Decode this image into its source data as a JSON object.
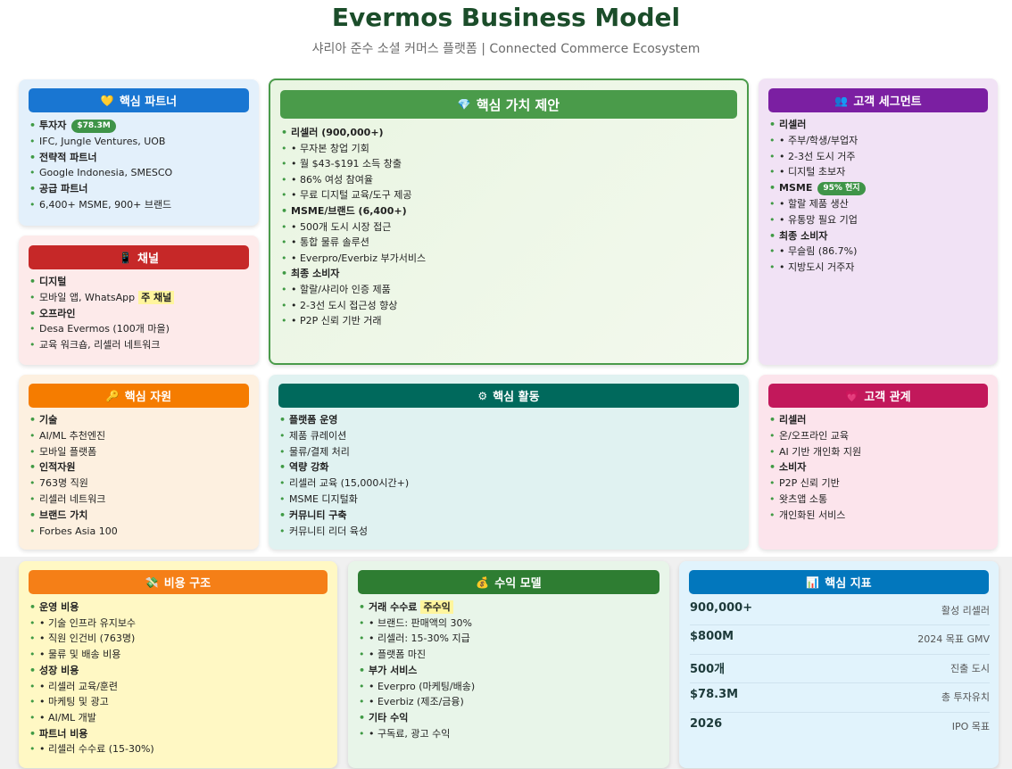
{
  "header": {
    "title": "Evermos Business Model",
    "subtitle": "샤리아 준수 소셜 커머스 플랫폼 | Connected Commerce Ecosystem"
  },
  "colors": {
    "partners": "#1976d2",
    "channels": "#c62828",
    "value": "#4a9b4a",
    "segments": "#7b1fa2",
    "resources": "#f57c00",
    "activities": "#00695c",
    "relations": "#c2185b",
    "cost": "#f57f17",
    "revenue": "#2e7d32",
    "metrics": "#0277bd"
  },
  "partners": {
    "icon": "handshake-icon",
    "title": "핵심 파트너",
    "items": [
      {
        "text": "투자자",
        "bold": true,
        "badge": "$78.3M"
      },
      {
        "text": "IFC, Jungle Ventures, UOB"
      },
      {
        "text": "전략적 파트너",
        "bold": true
      },
      {
        "text": "Google Indonesia, SMESCO"
      },
      {
        "text": "공급 파트너",
        "bold": true
      },
      {
        "text": "6,400+ MSME, 900+ 브랜드"
      }
    ]
  },
  "channels": {
    "icon": "mobile-phone-icon",
    "title": "채널",
    "items": [
      {
        "text": "디지털",
        "bold": true
      },
      {
        "text": "모바일 앱, WhatsApp",
        "highlight": "주 채널"
      },
      {
        "text": "오프라인",
        "bold": true
      },
      {
        "text": "Desa Evermos (100개 마을)"
      },
      {
        "text": "교육 워크숍, 리셀러 네트워크"
      }
    ]
  },
  "value": {
    "icon": "gem-icon",
    "title": "핵심 가치 제안",
    "items": [
      {
        "text": "리셀러 (900,000+)",
        "bold": true
      },
      {
        "text": "• 무자본 창업 기회"
      },
      {
        "text": "• 월 $43-$191 소득 창출"
      },
      {
        "text": "• 86% 여성 참여율"
      },
      {
        "text": "• 무료 디지털 교육/도구 제공"
      },
      {
        "text": "MSME/브랜드 (6,400+)",
        "bold": true
      },
      {
        "text": "• 500개 도시 시장 접근"
      },
      {
        "text": "• 통합 물류 솔루션"
      },
      {
        "text": "• Everpro/Everbiz 부가서비스"
      },
      {
        "text": "최종 소비자",
        "bold": true
      },
      {
        "text": "• 할랄/샤리아 인증 제품"
      },
      {
        "text": "• 2-3선 도시 접근성 향상"
      },
      {
        "text": "• P2P 신뢰 기반 거래"
      }
    ]
  },
  "segments": {
    "icon": "people-icon",
    "title": "고객 세그먼트",
    "items": [
      {
        "text": "리셀러",
        "bold": true
      },
      {
        "text": "• 주부/학생/부업자"
      },
      {
        "text": "• 2-3선 도시 거주"
      },
      {
        "text": "• 디지털 초보자"
      },
      {
        "text": "MSME",
        "bold": true,
        "badge": "95% 현지"
      },
      {
        "text": "• 할랄 제품 생산"
      },
      {
        "text": "• 유통망 필요 기업"
      },
      {
        "text": "최종 소비자",
        "bold": true
      },
      {
        "text": "• 무슬림 (86.7%)"
      },
      {
        "text": "• 지방도시 거주자"
      }
    ]
  },
  "resources": {
    "icon": "key-icon",
    "title": "핵심 자원",
    "items": [
      {
        "text": "기술",
        "bold": true
      },
      {
        "text": "AI/ML 추천엔진"
      },
      {
        "text": "모바일 플랫폼"
      },
      {
        "text": "인적자원",
        "bold": true
      },
      {
        "text": "763명 직원"
      },
      {
        "text": "리셀러 네트워크"
      },
      {
        "text": "브랜드 가치",
        "bold": true
      },
      {
        "text": "Forbes Asia 100"
      }
    ]
  },
  "activities": {
    "icon": "gear-icon",
    "title": "핵심 활동",
    "items": [
      {
        "text": "플랫폼 운영",
        "bold": true
      },
      {
        "text": "제품 큐레이션"
      },
      {
        "text": "물류/결제 처리"
      },
      {
        "text": "역량 강화",
        "bold": true
      },
      {
        "text": "리셀러 교육 (15,000시간+)"
      },
      {
        "text": "MSME 디지털화"
      },
      {
        "text": "커뮤니티 구축",
        "bold": true
      },
      {
        "text": "커뮤니티 리더 육성"
      }
    ]
  },
  "relations": {
    "icon": "heart-icon",
    "title": "고객 관계",
    "items": [
      {
        "text": "리셀러",
        "bold": true
      },
      {
        "text": "온/오프라인 교육"
      },
      {
        "text": "AI 기반 개인화 지원"
      },
      {
        "text": "소비자",
        "bold": true
      },
      {
        "text": "P2P 신뢰 기반"
      },
      {
        "text": "왓츠앱 소통"
      },
      {
        "text": "개인화된 서비스"
      }
    ]
  },
  "cost": {
    "icon": "money-icon",
    "title": "비용 구조",
    "items": [
      {
        "text": "운영 비용",
        "bold": true
      },
      {
        "text": "• 기술 인프라 유지보수"
      },
      {
        "text": "• 직원 인건비 (763명)"
      },
      {
        "text": "• 물류 및 배송 비용"
      },
      {
        "text": "성장 비용",
        "bold": true
      },
      {
        "text": "• 리셀러 교육/훈련"
      },
      {
        "text": "• 마케팅 및 광고"
      },
      {
        "text": "• AI/ML 개발"
      },
      {
        "text": "파트너 비용",
        "bold": true
      },
      {
        "text": "• 리셀러 수수료 (15-30%)"
      }
    ]
  },
  "revenue": {
    "icon": "money-bag-icon",
    "title": "수익 모델",
    "items": [
      {
        "text": "거래 수수료",
        "bold": true,
        "highlight": "주수익"
      },
      {
        "text": "• 브랜드: 판매액의 30%"
      },
      {
        "text": "• 리셀러: 15-30% 지급"
      },
      {
        "text": "• 플랫폼 마진"
      },
      {
        "text": "부가 서비스",
        "bold": true
      },
      {
        "text": "• Everpro (마케팅/배송)"
      },
      {
        "text": "• Everbiz (제조/금융)"
      },
      {
        "text": "기타 수익",
        "bold": true
      },
      {
        "text": "• 구독료, 광고 수익"
      }
    ]
  },
  "metrics": {
    "icon": "bar-chart-icon",
    "title": "핵심 지표",
    "rows": [
      {
        "value": "900,000+",
        "label": "활성 리셀러"
      },
      {
        "value": "$800M",
        "label": "2024 목표 GMV"
      },
      {
        "value": "500개",
        "label": "진출 도시"
      },
      {
        "value": "$78.3M",
        "label": "총 투자유치"
      },
      {
        "value": "2026",
        "label": "IPO 목표"
      }
    ]
  }
}
